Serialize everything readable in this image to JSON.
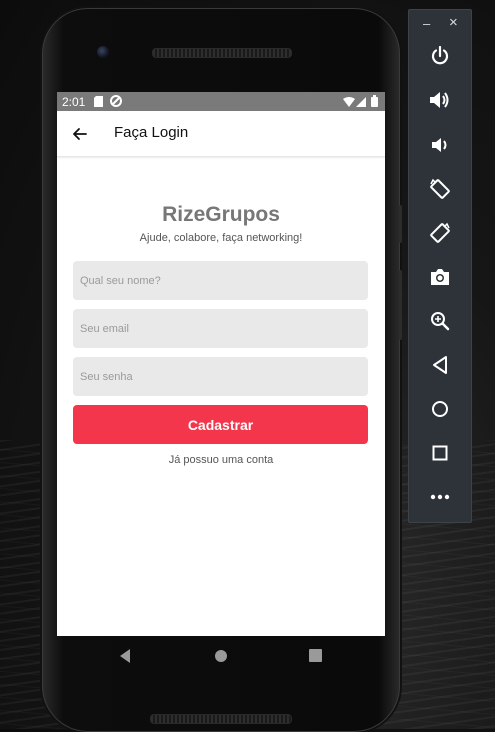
{
  "status_bar": {
    "time": "2:01"
  },
  "app_bar": {
    "title": "Faça Login"
  },
  "brand": {
    "name": "RizeGrupos",
    "tagline": "Ajude, colabore, faça networking!"
  },
  "form": {
    "name_placeholder": "Qual seu nome?",
    "email_placeholder": "Seu email",
    "password_placeholder": "Seu senha",
    "submit_label": "Cadastrar",
    "login_link": "Já possuo uma conta"
  },
  "colors": {
    "primary": "#f4364c",
    "status_bar": "#7a7a7a",
    "brand_text": "#777777",
    "field_bg": "#e9e9e9"
  },
  "toolbar": {
    "minimize": "–",
    "close": "×",
    "items": [
      "power-icon",
      "volume-up-icon",
      "volume-down-icon",
      "rotate-left-icon",
      "rotate-right-icon",
      "camera-icon",
      "zoom-icon",
      "back-icon",
      "home-icon",
      "overview-icon",
      "more-icon"
    ]
  }
}
